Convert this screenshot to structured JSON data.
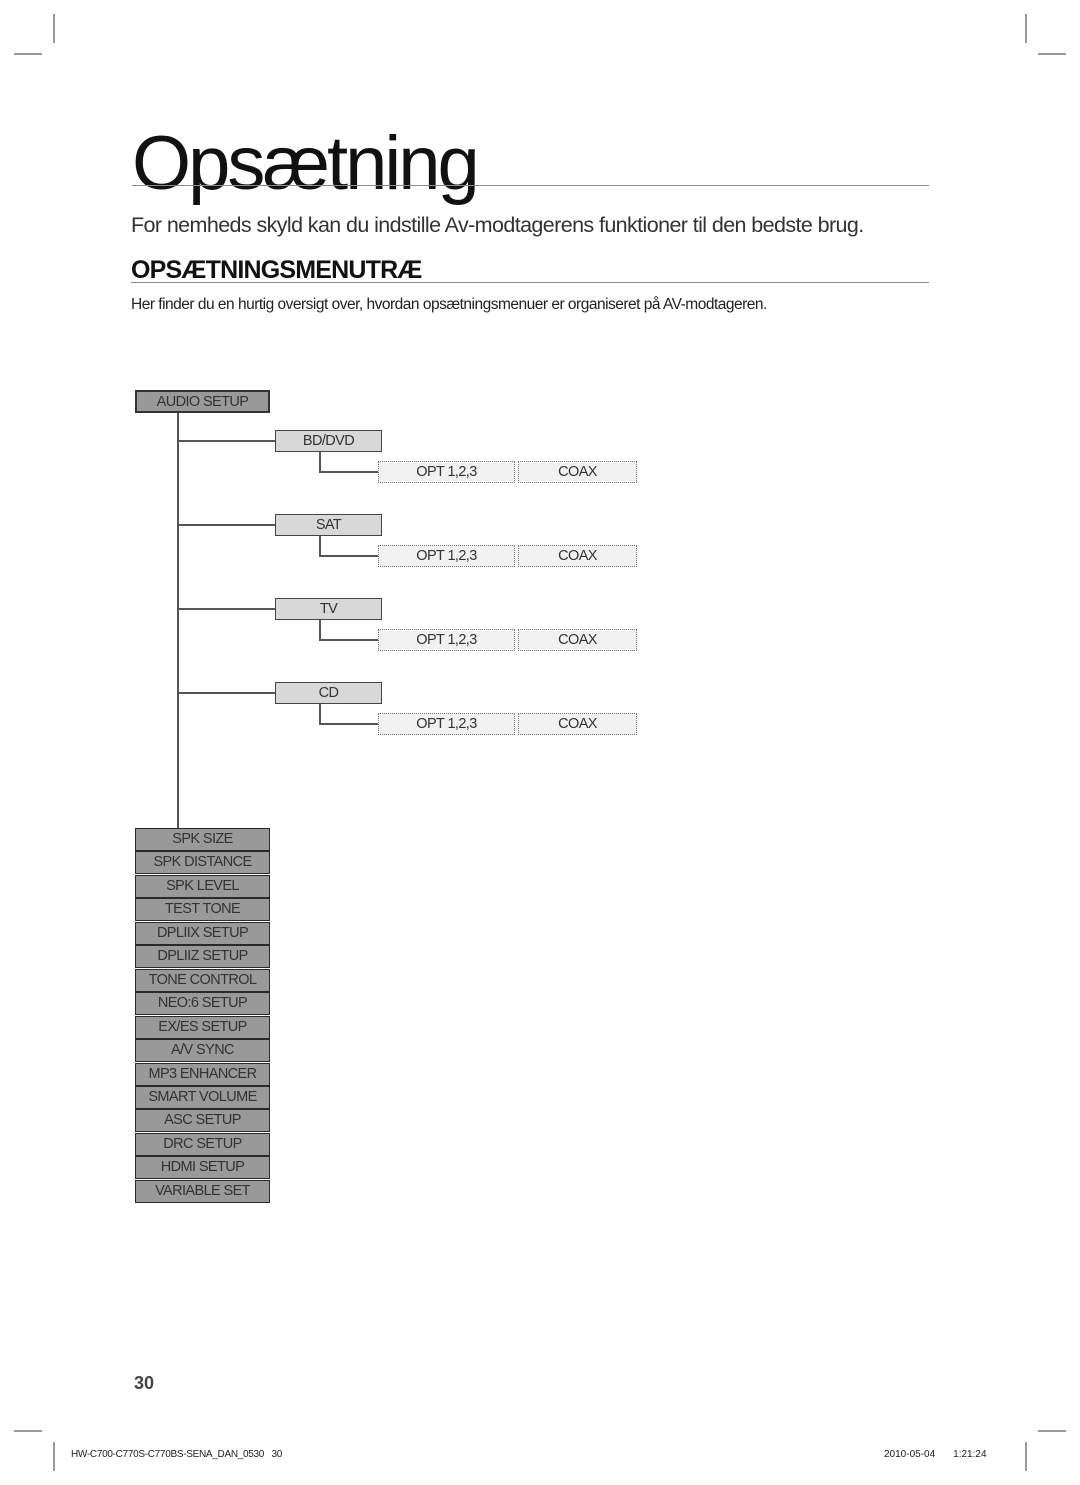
{
  "page": {
    "title": "Opsætning",
    "intro": "For nemheds skyld kan du indstille Av-modtagerens funktioner til den bedste brug.",
    "section_heading": "OPSÆTNINGSMENUTRÆ",
    "section_description": "Her finder du en hurtig oversigt over, hvordan opsætningsmenuer er organiseret på AV-modtageren.",
    "page_number": "30"
  },
  "tree": {
    "root": "AUDIO SETUP",
    "sources": [
      {
        "label": "BD/DVD",
        "options": [
          "OPT 1,2,3",
          "COAX"
        ]
      },
      {
        "label": "SAT",
        "options": [
          "OPT 1,2,3",
          "COAX"
        ]
      },
      {
        "label": "TV",
        "options": [
          "OPT 1,2,3",
          "COAX"
        ]
      },
      {
        "label": "CD",
        "options": [
          "OPT 1,2,3",
          "COAX"
        ]
      }
    ],
    "menu_items": [
      "SPK SIZE",
      "SPK DISTANCE",
      "SPK LEVEL",
      "TEST TONE",
      "DPLIIX SETUP",
      "DPLIIZ SETUP",
      "TONE CONTROL",
      "NEO:6 SETUP",
      "EX/ES SETUP",
      "A/V SYNC",
      "MP3 ENHANCER",
      "SMART VOLUME",
      "ASC SETUP",
      "DRC SETUP",
      "HDMI SETUP",
      "VARIABLE SET"
    ]
  },
  "footer": {
    "doc_id": "HW-C700-C770S-C770BS-SENA_DAN_0530   30",
    "date": "2010-05-04",
    "time": "1:21:24"
  }
}
